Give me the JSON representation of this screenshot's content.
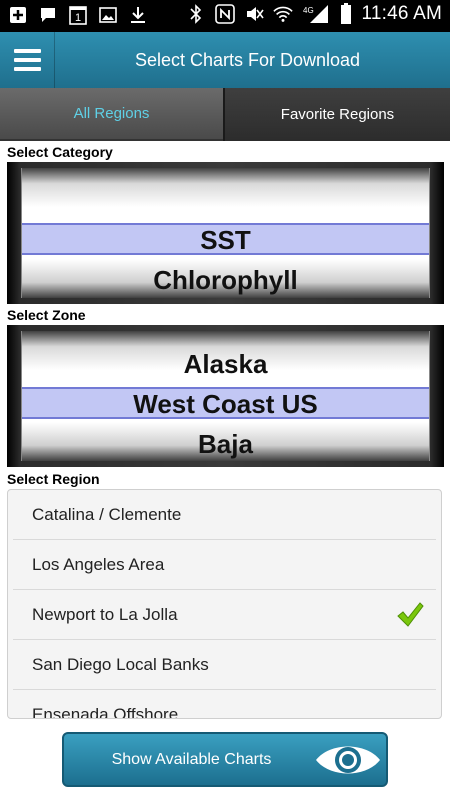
{
  "status_bar": {
    "time": "11:46 AM",
    "network": "4G",
    "left_icons": [
      "add-icon",
      "message-icon",
      "calendar-icon",
      "image-icon",
      "download-icon"
    ],
    "right_icons": [
      "bluetooth-icon",
      "nfc-icon",
      "mute-icon",
      "wifi-icon",
      "signal-icon",
      "battery-icon"
    ],
    "calendar_day": "1"
  },
  "toolbar": {
    "title": "Select Charts For Download",
    "menu_icon": "hamburger-menu-icon"
  },
  "tabs": [
    {
      "label": "All Regions",
      "active": true
    },
    {
      "label": "Favorite Regions",
      "active": false
    }
  ],
  "category": {
    "label": "Select Category",
    "items": [
      "",
      "SST",
      "Chlorophyll"
    ],
    "selected": "SST"
  },
  "zone": {
    "label": "Select Zone",
    "items": [
      "Alaska",
      "West Coast US",
      "Baja"
    ],
    "selected": "West Coast US"
  },
  "region": {
    "label": "Select Region",
    "items": [
      {
        "name": "Catalina / Clemente",
        "checked": false
      },
      {
        "name": "Los Angeles Area",
        "checked": false
      },
      {
        "name": "Newport to La Jolla",
        "checked": true
      },
      {
        "name": "San Diego Local Banks",
        "checked": false
      },
      {
        "name": "Ensenada Offshore",
        "checked": false
      }
    ]
  },
  "show_button": {
    "label": "Show Available Charts",
    "icon": "eye-icon"
  },
  "colors": {
    "accent": "#2e8fb0",
    "tab_active_text": "#5fd0e6",
    "check_green": "#7ac70c"
  }
}
